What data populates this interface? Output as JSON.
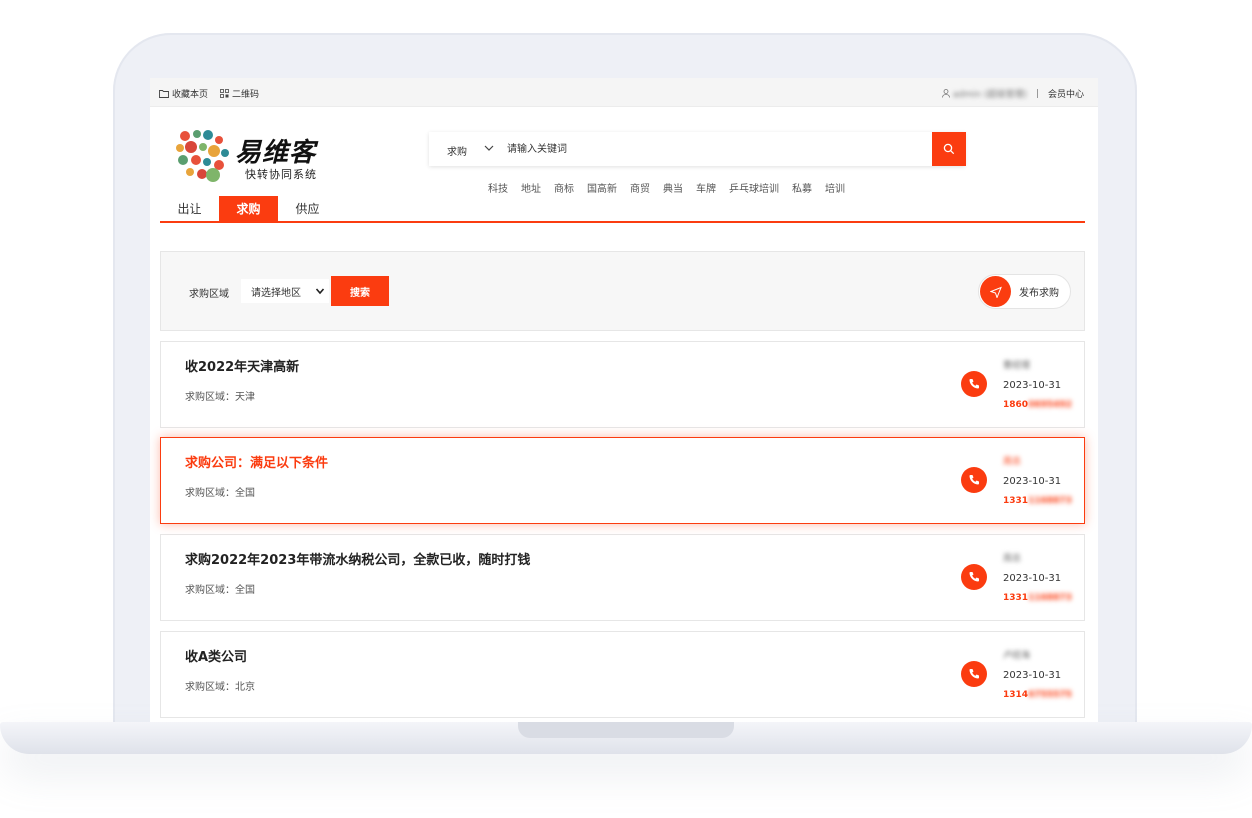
{
  "topbar": {
    "bookmark": "收藏本页",
    "qrcode": "二维码",
    "user": "admin (超级管理)",
    "member_center": "会员中心"
  },
  "logo": {
    "title": "易维客",
    "subtitle": "快转协同系统"
  },
  "search": {
    "type": "求购",
    "placeholder": "请输入关键词",
    "hot_words": [
      "科技",
      "地址",
      "商标",
      "国高新",
      "商贸",
      "典当",
      "车牌",
      "乒乓球培训",
      "私募",
      "培训"
    ]
  },
  "tabs": [
    {
      "label": "出让",
      "active": false
    },
    {
      "label": "求购",
      "active": true
    },
    {
      "label": "供应",
      "active": false
    }
  ],
  "filter": {
    "label": "求购区域",
    "select_value": "请选择地区",
    "search_label": "搜索",
    "publish_label": "发布求购"
  },
  "listings": [
    {
      "title": "收2022年天津高新",
      "region": "求购区域：天津",
      "contact": "曹经理",
      "date": "2023-10-31",
      "phone_prefix": "1860",
      "phone_hidden": "0695492"
    },
    {
      "title": "求购公司：满足以下条件",
      "region": "求购区域：全国",
      "contact": "周总",
      "date": "2023-10-31",
      "phone_prefix": "1331",
      "phone_hidden": "1168873"
    },
    {
      "title": "求购2022年2023年带流水纳税公司，全款已收，随时打钱",
      "region": "求购区域：全国",
      "contact": "周总",
      "date": "2023-10-31",
      "phone_prefix": "1331",
      "phone_hidden": "1168873"
    },
    {
      "title": "收A类公司",
      "region": "求购区域：北京",
      "contact": "卢经海",
      "date": "2023-10-31",
      "phone_prefix": "1314",
      "phone_hidden": "6755575"
    }
  ],
  "colors": {
    "accent": "#fb3c10"
  }
}
